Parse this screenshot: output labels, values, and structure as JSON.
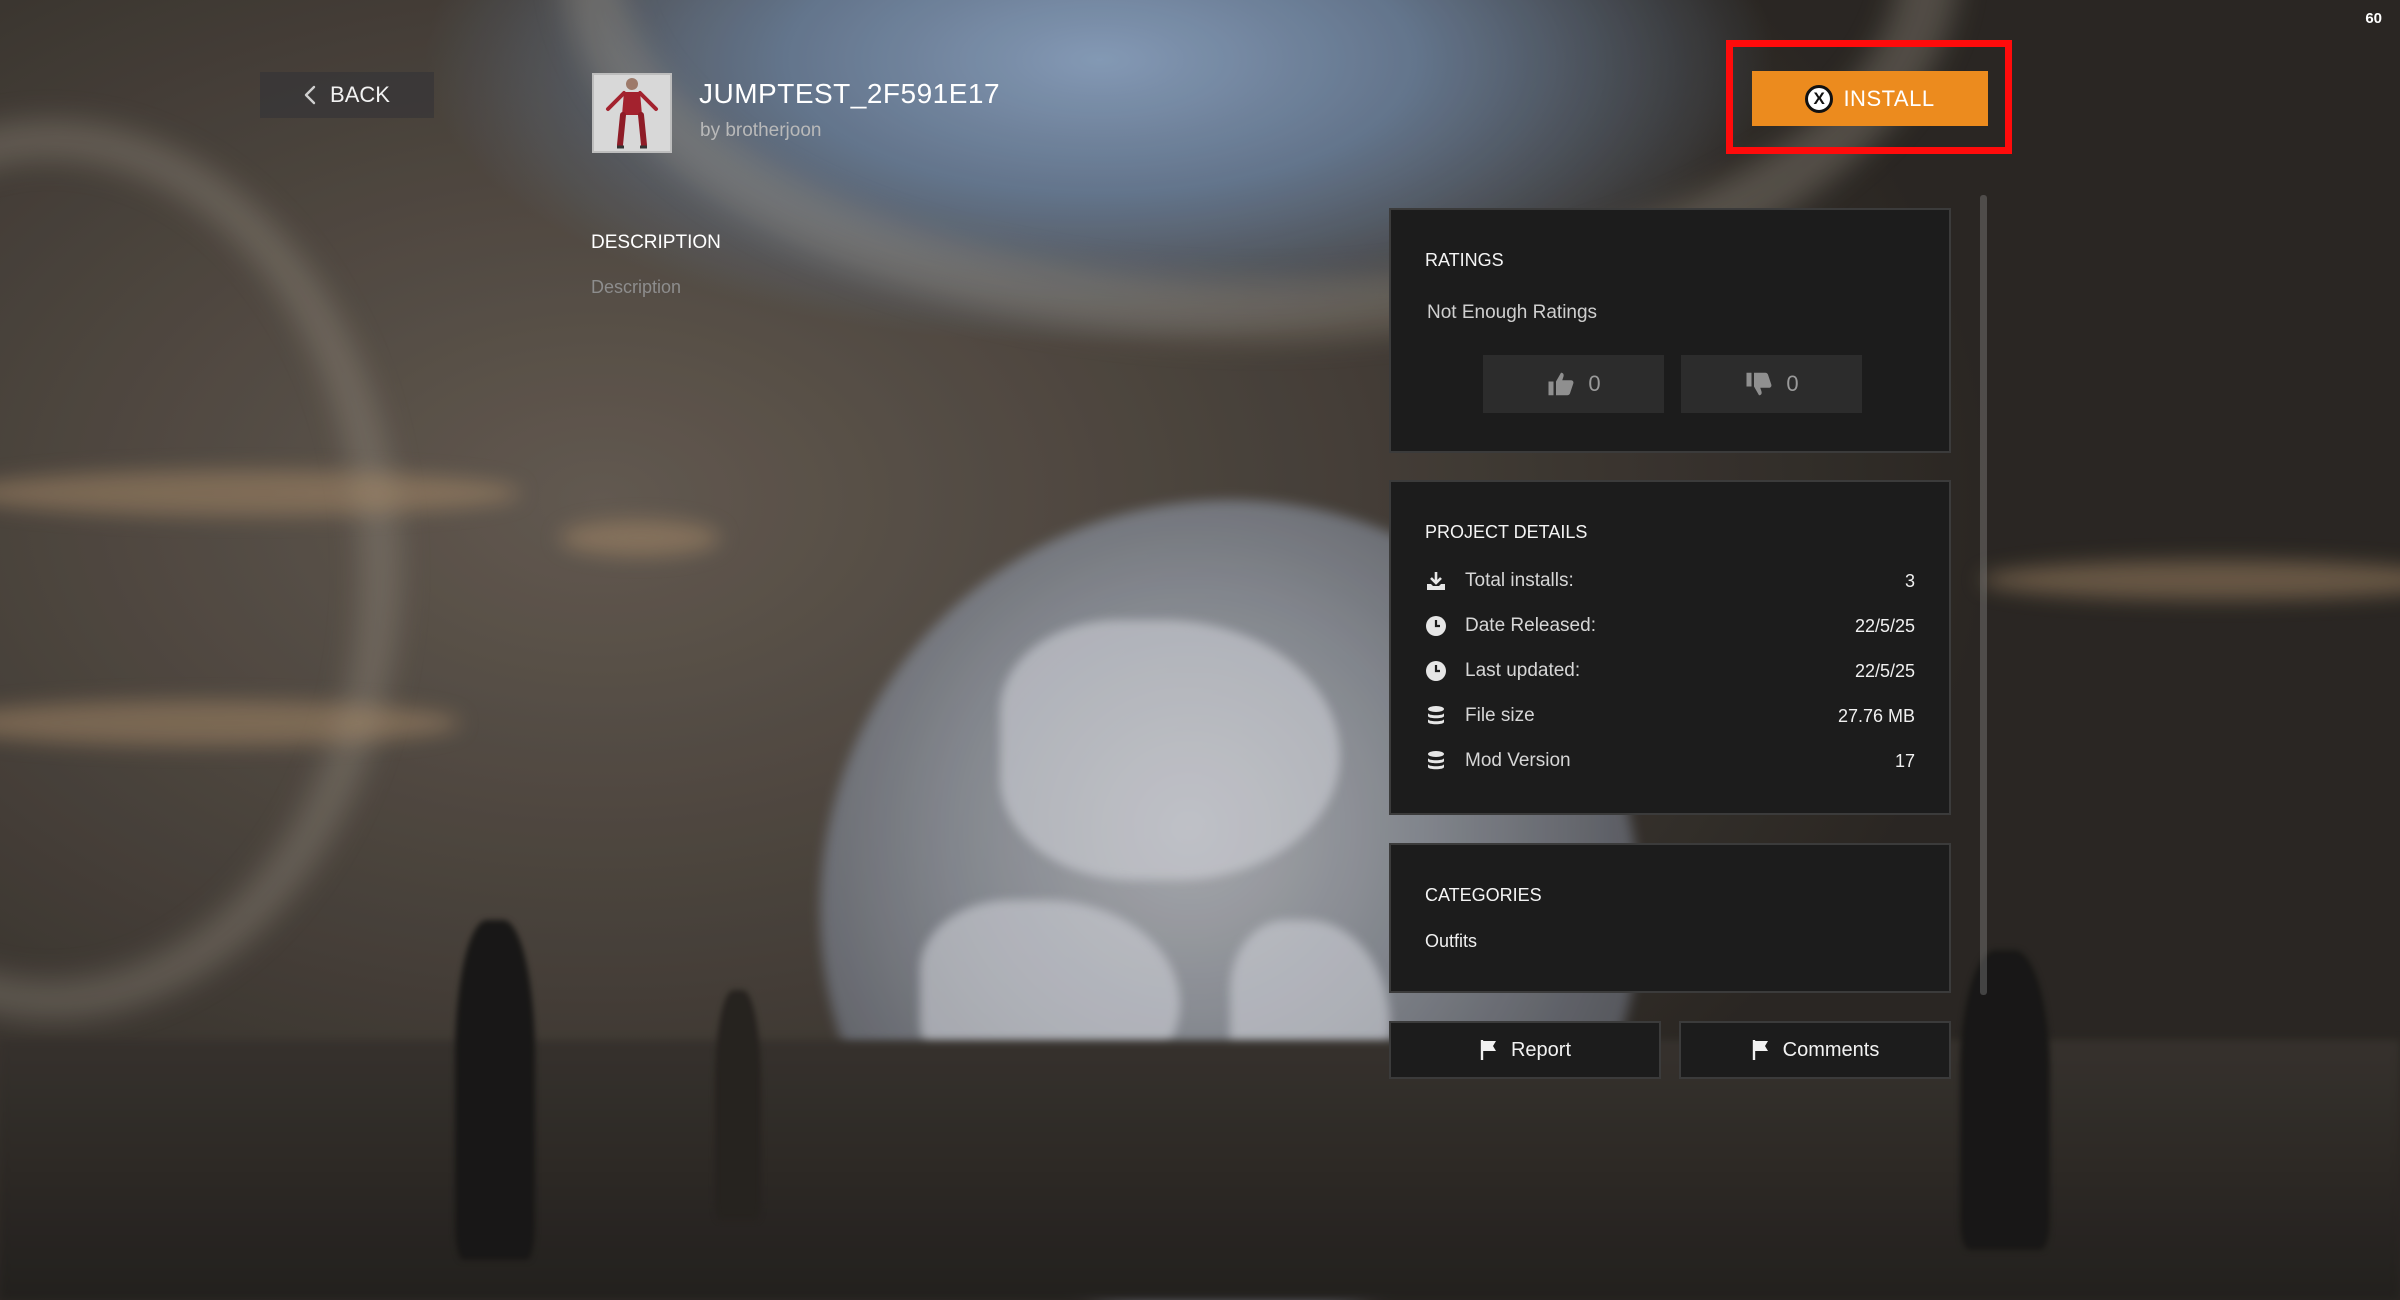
{
  "status": {
    "fps": "60"
  },
  "nav": {
    "back_label": "BACK"
  },
  "mod": {
    "title": "JUMPTEST_2F591E17",
    "author": "by brotherjoon",
    "thumbnail_icon": "character-outfit-thumbnail"
  },
  "description": {
    "heading": "DESCRIPTION",
    "text": "Description"
  },
  "install": {
    "label": "INSTALL",
    "button_glyph": "X",
    "accent": "#ec8b1e",
    "highlight": "#ff0b0b"
  },
  "ratings": {
    "heading": "RATINGS",
    "summary": "Not Enough Ratings",
    "thumbs_up": "0",
    "thumbs_down": "0"
  },
  "details": {
    "heading": "PROJECT DETAILS",
    "rows": [
      {
        "icon": "download-icon",
        "label": "Total installs:",
        "value": "3"
      },
      {
        "icon": "clock-icon",
        "label": "Date Released:",
        "value": "22/5/25"
      },
      {
        "icon": "clock-icon",
        "label": "Last updated:",
        "value": "22/5/25"
      },
      {
        "icon": "database-icon",
        "label": "File size",
        "value": "27.76 MB"
      },
      {
        "icon": "database-icon",
        "label": "Mod Version",
        "value": "17"
      }
    ]
  },
  "categories": {
    "heading": "CATEGORIES",
    "items": [
      "Outfits"
    ]
  },
  "actions": {
    "report_label": "Report",
    "comments_label": "Comments"
  }
}
